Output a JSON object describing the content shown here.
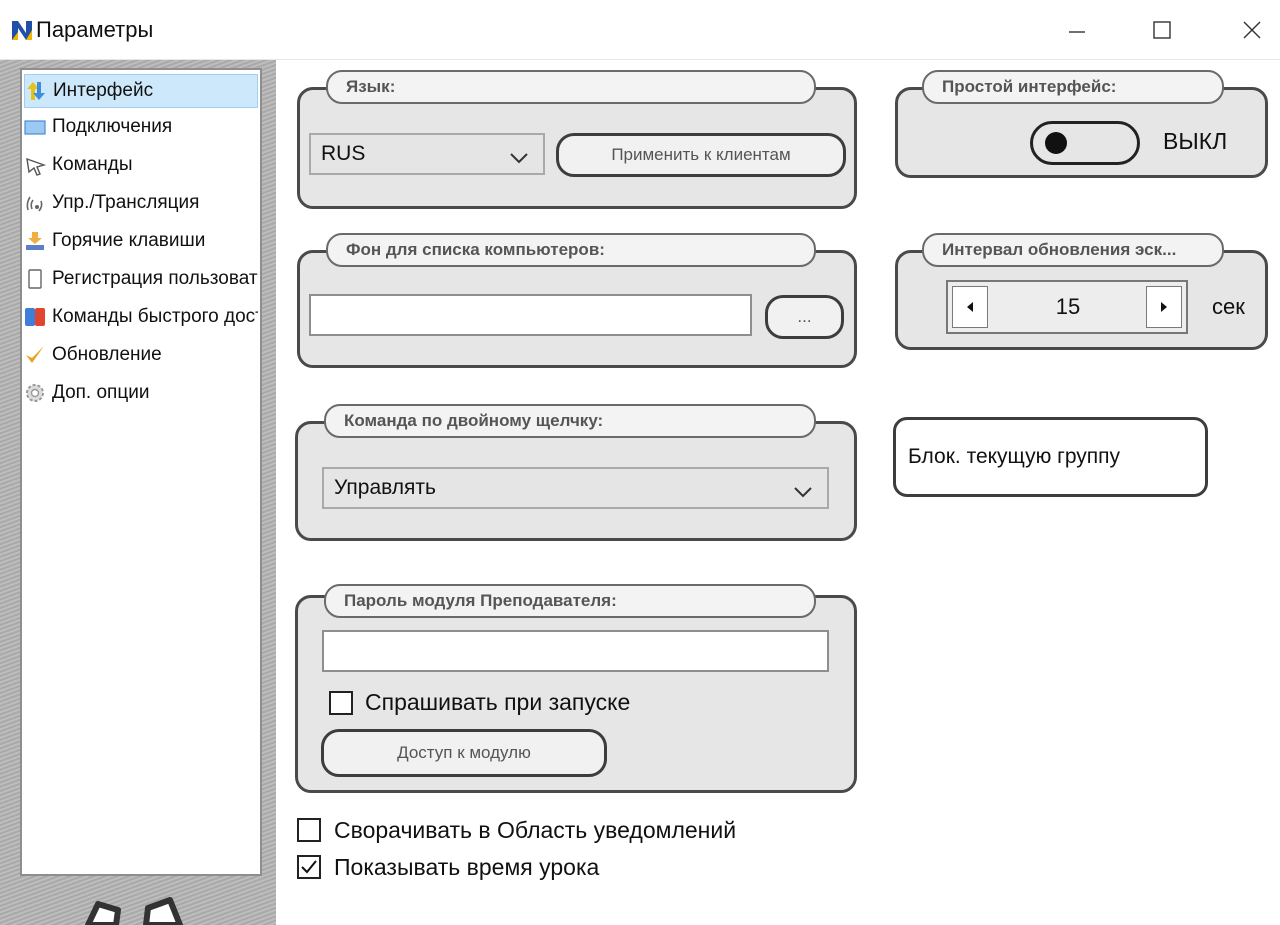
{
  "window": {
    "title": "Параметры"
  },
  "sidebar": {
    "items": [
      {
        "label": "Интерфейс",
        "icon": "arrows-icon",
        "selected": true
      },
      {
        "label": "Подключения",
        "icon": "monitor-icon"
      },
      {
        "label": "Команды",
        "icon": "cursor-icon"
      },
      {
        "label": "Упр./Трансляция",
        "icon": "broadcast-icon"
      },
      {
        "label": "Горячие клавиши",
        "icon": "hotkey-icon"
      },
      {
        "label": "Регистрация пользователей",
        "icon": "page-icon"
      },
      {
        "label": "Команды быстрого доступа",
        "icon": "quick-commands-icon"
      },
      {
        "label": "Обновление",
        "icon": "checkmark-icon"
      },
      {
        "label": "Доп. опции",
        "icon": "gear-icon"
      }
    ]
  },
  "language": {
    "label": "Язык:",
    "value": "RUS",
    "apply_button": "Применить к клиентам"
  },
  "simple_interface": {
    "label": "Простой интерфейс:",
    "state": "ВЫКЛ"
  },
  "background": {
    "label": "Фон для списка компьютеров:",
    "value": "",
    "browse_button": "..."
  },
  "refresh_interval": {
    "label": "Интервал обновления эск...",
    "value": "15",
    "unit": "сек"
  },
  "double_click": {
    "label": "Команда по двойному щелчку:",
    "value": "Управлять"
  },
  "block_group_button": "Блок. текущую группу",
  "teacher_password": {
    "label": "Пароль модуля Преподавателя:",
    "value": "",
    "ask_on_start": "Спрашивать при запуске",
    "ask_on_start_checked": false,
    "access_button": "Доступ к модулю"
  },
  "options": {
    "minimize_to_tray": "Сворачивать в Область уведомлений",
    "minimize_to_tray_checked": false,
    "show_lesson_time": "Показывать время урока",
    "show_lesson_time_checked": true
  }
}
